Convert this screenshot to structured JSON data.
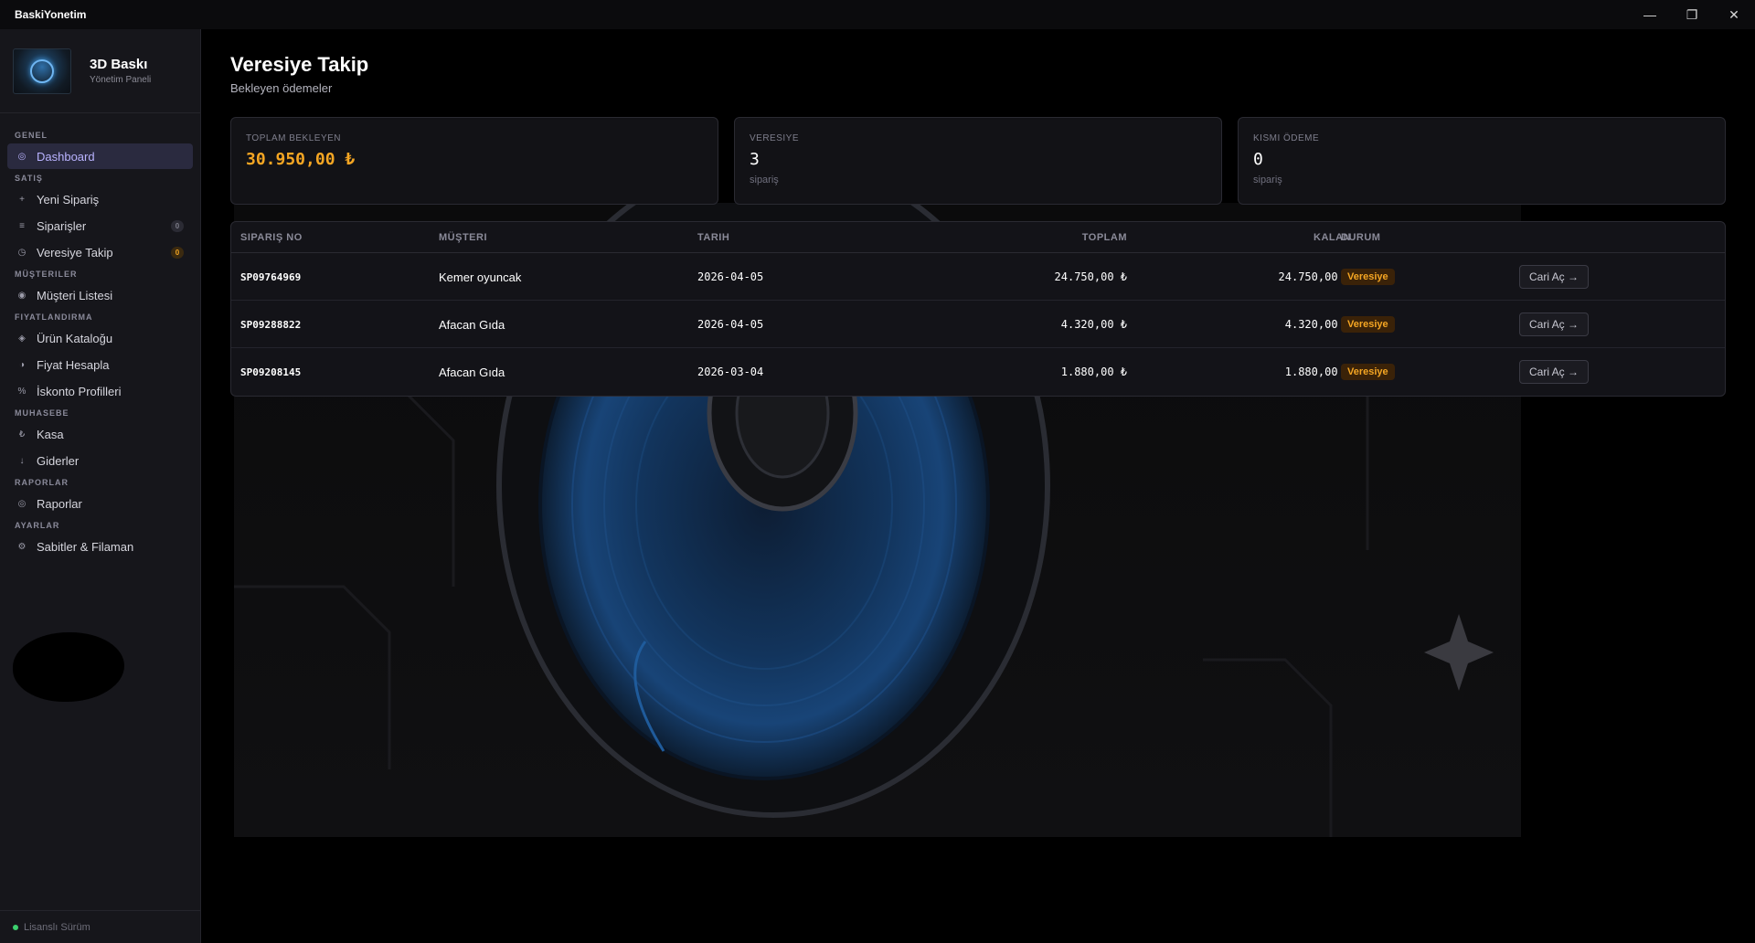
{
  "window": {
    "title": "BaskiYonetim",
    "controls": {
      "minimize": "—",
      "maximize": "❐",
      "close": "✕"
    }
  },
  "brand": {
    "title": "3D Baskı",
    "subtitle": "Yönetim Paneli"
  },
  "sidebar": {
    "sections": [
      {
        "label": "GENEL",
        "items": [
          {
            "label": "Dashboard",
            "icon": "◎",
            "active": true
          }
        ]
      },
      {
        "label": "SATIŞ",
        "items": [
          {
            "label": "Yeni Sipariş",
            "icon": "+"
          },
          {
            "label": "Siparişler",
            "icon": "≡",
            "badge": "0"
          },
          {
            "label": "Veresiye Takip",
            "icon": "◷",
            "badge": "0"
          }
        ]
      },
      {
        "label": "MÜŞTERILER",
        "items": [
          {
            "label": "Müşteri Listesi",
            "icon": "◉"
          }
        ]
      },
      {
        "label": "FIYATLANDIRMA",
        "items": [
          {
            "label": "Ürün Kataloğu",
            "icon": "◈"
          },
          {
            "label": "Fiyat Hesapla",
            "icon": "◑"
          },
          {
            "label": "İskonto Profilleri",
            "icon": "%"
          }
        ]
      },
      {
        "label": "MUHASEBE",
        "items": [
          {
            "label": "Kasa",
            "icon": "₺"
          },
          {
            "label": "Giderler",
            "icon": "↓"
          }
        ]
      },
      {
        "label": "RAPORLAR",
        "items": [
          {
            "label": "Raporlar",
            "icon": "◎"
          }
        ]
      },
      {
        "label": "AYARLAR",
        "items": [
          {
            "label": "Sabitler & Filaman",
            "icon": "⚙"
          }
        ]
      }
    ],
    "license": "Lisanslı Sürüm"
  },
  "page": {
    "title": "Veresiye Takip",
    "subtitle": "Bekleyen ödemeler"
  },
  "stats": [
    {
      "label": "TOPLAM BEKLEYEN",
      "value": "30.950,00 ₺",
      "unit": ""
    },
    {
      "label": "VERESIYE",
      "value": "3",
      "unit": "sipariş"
    },
    {
      "label": "KISMI ÖDEME",
      "value": "0",
      "unit": "sipariş"
    }
  ],
  "table": {
    "headers": {
      "order_no": "SIPARIŞ NO",
      "customer": "MÜŞTERI",
      "date": "TARIH",
      "total": "TOPLAM",
      "remaining": "KALAN",
      "status": "DURUM"
    },
    "rows": [
      {
        "order_no": "SP09764969",
        "customer": "Kemer oyuncak",
        "date": "2026-04-05",
        "total": "24.750,00 ₺",
        "remaining": "24.750,00 ₺",
        "status": "Veresiye",
        "action": "Cari Aç →"
      },
      {
        "order_no": "SP09288822",
        "customer": "Afacan Gıda",
        "date": "2026-04-05",
        "total": "4.320,00 ₺",
        "remaining": "4.320,00 ₺",
        "status": "Veresiye",
        "action": "Cari Aç →"
      },
      {
        "order_no": "SP09208145",
        "customer": "Afacan Gıda",
        "date": "2026-03-04",
        "total": "1.880,00 ₺",
        "remaining": "1.880,00 ₺",
        "status": "Veresiye",
        "action": "Cari Aç →"
      }
    ]
  },
  "colors": {
    "accent": "#b9b3ff",
    "warning": "#f5a623",
    "license_dot": "#3ccf6e"
  }
}
